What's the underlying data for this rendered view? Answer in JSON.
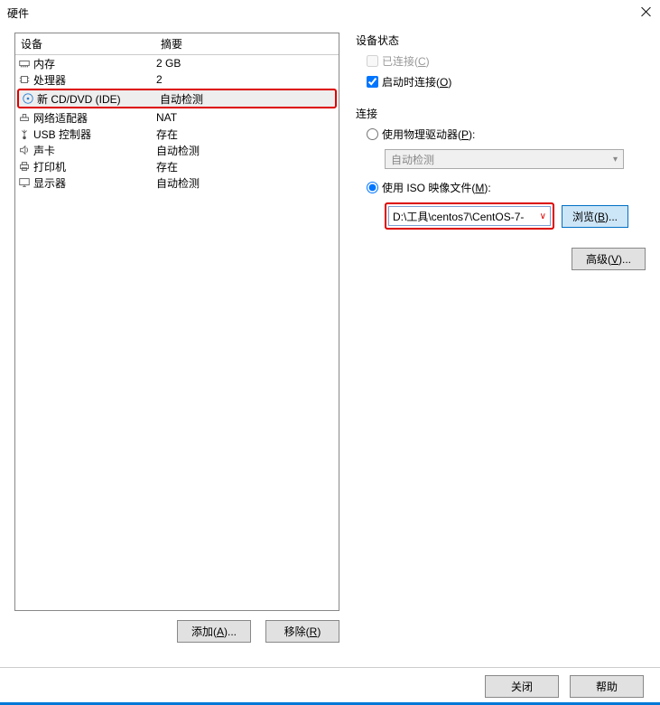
{
  "window_title": "硬件",
  "columns": {
    "device": "设备",
    "summary": "摘要"
  },
  "devices": [
    {
      "icon": "memory-icon",
      "name": "内存",
      "summary": "2 GB",
      "selected": false
    },
    {
      "icon": "cpu-icon",
      "name": "处理器",
      "summary": "2",
      "selected": false
    },
    {
      "icon": "cd-icon",
      "name": "新 CD/DVD (IDE)",
      "summary": "自动检测",
      "selected": true
    },
    {
      "icon": "network-icon",
      "name": "网络适配器",
      "summary": "NAT",
      "selected": false
    },
    {
      "icon": "usb-icon",
      "name": "USB 控制器",
      "summary": "存在",
      "selected": false
    },
    {
      "icon": "sound-icon",
      "name": "声卡",
      "summary": "自动检测",
      "selected": false
    },
    {
      "icon": "printer-icon",
      "name": "打印机",
      "summary": "存在",
      "selected": false
    },
    {
      "icon": "display-icon",
      "name": "显示器",
      "summary": "自动检测",
      "selected": false
    }
  ],
  "buttons": {
    "add": "添加(A)...",
    "remove": "移除(R)",
    "advanced": "高级(V)...",
    "browse": "浏览(B)...",
    "close": "关闭",
    "help": "帮助"
  },
  "device_state": {
    "title": "设备状态",
    "connected": "已连接(C)",
    "connect_at_power": "启动时连接(O)"
  },
  "connection": {
    "title": "连接",
    "use_physical": "使用物理驱动器(P):",
    "autodetect": "自动检测",
    "use_iso": "使用 ISO 映像文件(M):",
    "iso_path": "D:\\工具\\centos7\\CentOS-7-"
  }
}
